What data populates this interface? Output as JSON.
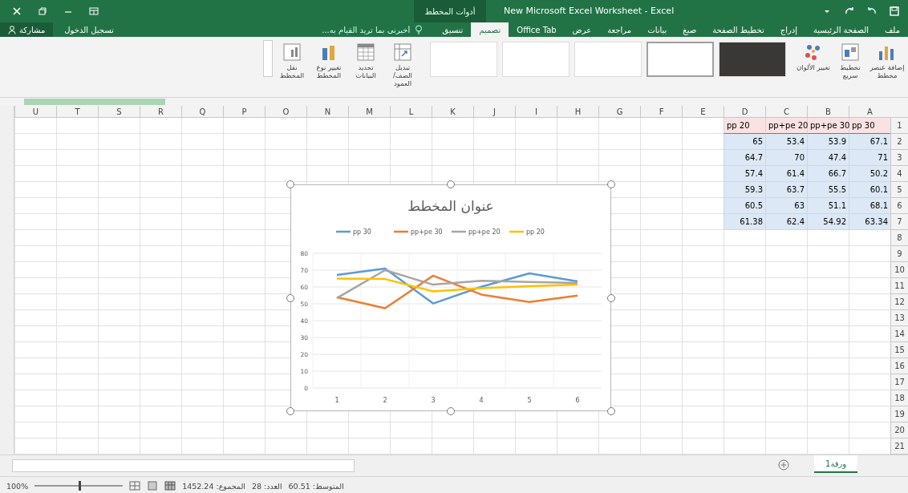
{
  "window": {
    "title": "New Microsoft Excel Worksheet - Excel",
    "context_group": "أدوات المخطط"
  },
  "tabs": [
    {
      "label": "ملف",
      "selected": false
    },
    {
      "label": "الصفحة الرئيسية",
      "selected": false
    },
    {
      "label": "إدراج",
      "selected": false
    },
    {
      "label": "تخطيط الصفحة",
      "selected": false
    },
    {
      "label": "صيغ",
      "selected": false
    },
    {
      "label": "بيانات",
      "selected": false
    },
    {
      "label": "مراجعة",
      "selected": false
    },
    {
      "label": "عرض",
      "selected": false
    },
    {
      "label": "Office Tab",
      "selected": false
    },
    {
      "label": "تصميم",
      "selected": true
    },
    {
      "label": "تنسيق",
      "selected": false
    }
  ],
  "tell_me": {
    "placeholder": "أخبرني بما تريد القيام به..."
  },
  "sign_in": "تسجيل الدخول",
  "share": "مشاركة",
  "ribbon": {
    "buttons": [
      {
        "label": "إضافة عنصر مخطط",
        "kind": "add"
      },
      {
        "label": "تخطيط سريع",
        "kind": "layout"
      },
      {
        "label": "تغيير الألوان",
        "kind": "colors"
      },
      {
        "kind": "gallery"
      },
      {
        "label": "تبديل الصف/العمود",
        "kind": "switch"
      },
      {
        "label": "تحديد البيانات",
        "kind": "data"
      },
      {
        "label": "تغيير نوع المخطط",
        "kind": "type"
      },
      {
        "label": "نقل المخطط",
        "kind": "move"
      }
    ],
    "chart_styles": [
      {
        "kind": "dark",
        "selected": false
      },
      {
        "kind": "light",
        "selected": true
      },
      {
        "kind": "light",
        "selected": false
      },
      {
        "kind": "light",
        "selected": false
      },
      {
        "kind": "light",
        "selected": false
      }
    ]
  },
  "columns": [
    "A",
    "B",
    "C",
    "D",
    "E",
    "F",
    "G",
    "H",
    "I",
    "J",
    "K",
    "L",
    "M",
    "N",
    "O",
    "P",
    "Q",
    "R",
    "S",
    "T",
    "U"
  ],
  "rows": [
    "1",
    "2",
    "3",
    "4",
    "5",
    "6",
    "7",
    "8",
    "9",
    "10",
    "11",
    "12",
    "13",
    "14",
    "15",
    "16",
    "17",
    "18",
    "19",
    "20",
    "21"
  ],
  "table": {
    "header": [
      "pp 30",
      "pp+pe 30",
      "pp+pe 20",
      "pp 20"
    ],
    "rows": [
      [
        "67.1",
        "53.9",
        "53.4",
        "65"
      ],
      [
        "71",
        "47.4",
        "70",
        "64.7"
      ],
      [
        "50.2",
        "66.7",
        "61.4",
        "57.4"
      ],
      [
        "60.1",
        "55.5",
        "63.7",
        "59.3"
      ],
      [
        "68.1",
        "51.1",
        "63",
        "60.5"
      ],
      [
        "63.34",
        "54.92",
        "62.4",
        "61.38"
      ]
    ]
  },
  "chart": {
    "chart_data": {
      "type": "line",
      "title": "عنوان المخطط",
      "legend": true,
      "grid": true,
      "categories": [
        "1",
        "2",
        "3",
        "4",
        "5",
        "6"
      ],
      "ylim": [
        0,
        80
      ],
      "yticks": [
        {
          "value": 0,
          "label": "0"
        },
        {
          "value": 10,
          "label": "10"
        },
        {
          "value": 20,
          "label": "20"
        },
        {
          "value": 30,
          "label": "30"
        },
        {
          "value": 40,
          "label": "40"
        },
        {
          "value": 50,
          "label": "50"
        },
        {
          "value": 60,
          "label": "60"
        },
        {
          "value": 70,
          "label": "70"
        },
        {
          "value": 80,
          "label": "80"
        }
      ],
      "series": [
        {
          "name": "pp 30",
          "color": "#5b9bd5",
          "values": [
            67.1,
            71,
            50.2,
            60.1,
            68.1,
            63.3
          ]
        },
        {
          "name": "pp+pe 30",
          "color": "#ed7d31",
          "values": [
            53.9,
            47.4,
            66.7,
            55.5,
            51.1,
            54.9
          ]
        },
        {
          "name": "pp+pe 20",
          "color": "#a5a5a5",
          "values": [
            53.4,
            70,
            61.4,
            63.7,
            63,
            62.4
          ]
        },
        {
          "name": "pp 20",
          "color": "#ffc000",
          "values": [
            65,
            64.7,
            57.4,
            59.3,
            60.5,
            61.4
          ]
        }
      ]
    }
  },
  "sheet_tabs": [
    {
      "label": "ورقة1",
      "selected": true
    }
  ],
  "status_bar": {
    "average": "المتوسط: 60.51",
    "count": "العدد: 28",
    "sum": "المجموع: 1452.24",
    "zoom": "100%",
    "zoom_slider": {
      "level": 0.5
    }
  }
}
